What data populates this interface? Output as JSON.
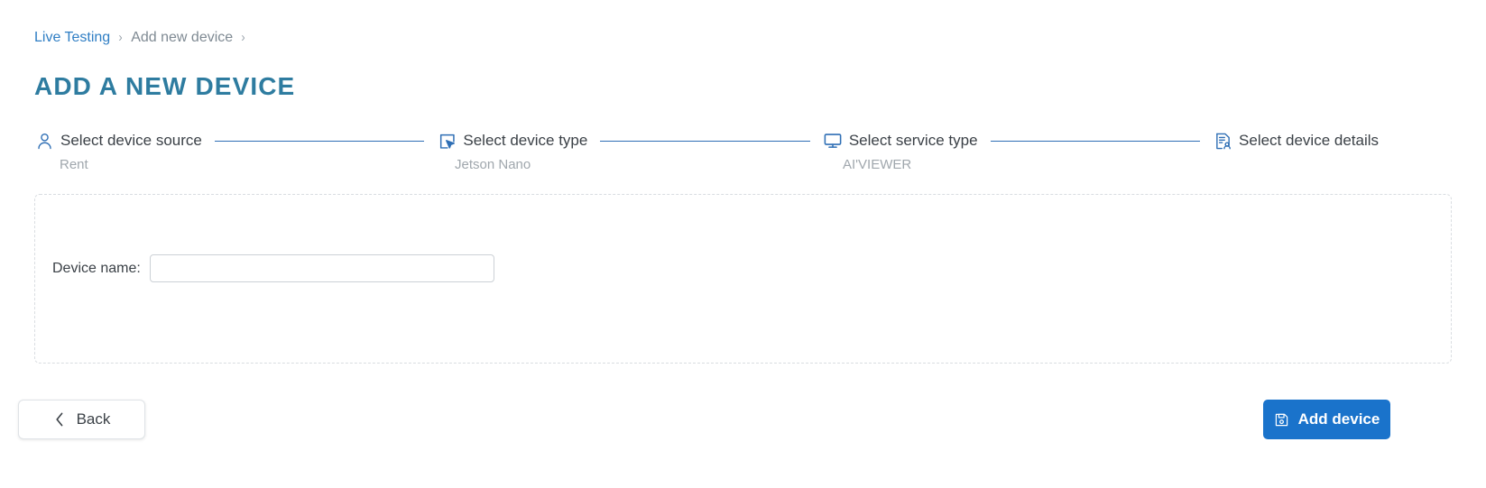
{
  "breadcrumb": {
    "items": [
      {
        "label": "Live Testing",
        "type": "link"
      },
      {
        "label": "Add new device",
        "type": "current"
      }
    ],
    "separator": "›"
  },
  "page": {
    "title": "ADD A NEW DEVICE",
    "title_color": "#2e7ca0"
  },
  "stepper": {
    "steps": [
      {
        "icon": "user-icon",
        "label": "Select device source",
        "sub": "Rent"
      },
      {
        "icon": "select-cursor-icon",
        "label": "Select device type",
        "sub": "Jetson Nano"
      },
      {
        "icon": "monitor-icon",
        "label": "Select service type",
        "sub": "AI'VIEWER"
      },
      {
        "icon": "device-details-icon",
        "label": "Select device details",
        "sub": ""
      }
    ],
    "connector_color": "#2f6fb5"
  },
  "form": {
    "device_name_label": "Device name:",
    "device_name_value": "",
    "device_name_placeholder": ""
  },
  "footer": {
    "back_label": "Back",
    "back_icon": "chevron-left-icon",
    "add_label": "Add device",
    "add_icon": "save-floppy-icon",
    "add_button_color": "#1a73cb"
  }
}
